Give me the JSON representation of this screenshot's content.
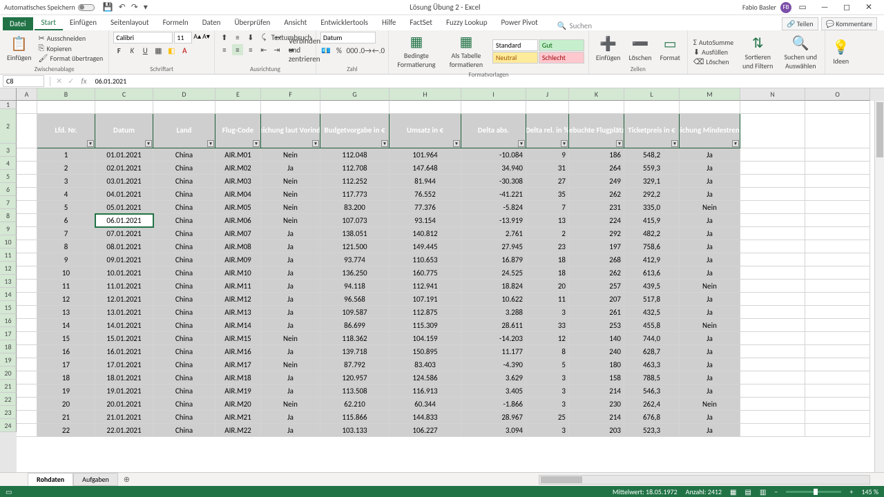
{
  "titlebar": {
    "autosave": "Automatisches Speichern",
    "file_title": "Lösung Übung 2 - Excel",
    "user_name": "Fabio Basler",
    "user_initials": "FB"
  },
  "tabs": {
    "file": "Datei",
    "items": [
      "Start",
      "Einfügen",
      "Seitenlayout",
      "Formeln",
      "Daten",
      "Überprüfen",
      "Ansicht",
      "Entwicklertools",
      "Hilfe",
      "FactSet",
      "Fuzzy Lookup",
      "Power Pivot"
    ],
    "active": "Start",
    "search_placeholder": "Suchen",
    "share": "Teilen",
    "comments": "Kommentare"
  },
  "ribbon": {
    "paste": "Einfügen",
    "cut": "Ausschneiden",
    "copy": "Kopieren",
    "format_painter": "Format übertragen",
    "clipboard_label": "Zwischenablage",
    "font_name": "Calibri",
    "font_size": "11",
    "font_label": "Schriftart",
    "wrap": "Textumbruch",
    "merge": "Verbinden und zentrieren",
    "align_label": "Ausrichtung",
    "num_format": "Datum",
    "num_label": "Zahl",
    "cond_fmt": "Bedingte Formatierung",
    "as_table": "Als Tabelle formatieren",
    "style_standard": "Standard",
    "style_gut": "Gut",
    "style_neutral": "Neutral",
    "style_schlecht": "Schlecht",
    "styles_label": "Formatvorlagen",
    "insert": "Einfügen",
    "delete": "Löschen",
    "format": "Format",
    "cells_label": "Zellen",
    "autosum": "AutoSumme",
    "fill": "Ausfüllen",
    "clear": "Löschen",
    "sort": "Sortieren und Filtern",
    "find": "Suchen und Auswählen",
    "ideas": "Ideen"
  },
  "formula_bar": {
    "cell_ref": "C8",
    "value": "06.01.2021"
  },
  "columns": [
    "A",
    "B",
    "C",
    "D",
    "E",
    "F",
    "G",
    "H",
    "I",
    "J",
    "K",
    "L",
    "M",
    "N",
    "O"
  ],
  "row_numbers": [
    "1",
    "2",
    "3",
    "4",
    "5",
    "6",
    "7",
    "8",
    "9",
    "10",
    "11",
    "12",
    "13",
    "14",
    "15",
    "16",
    "17",
    "18",
    "19",
    "20",
    "21",
    "22",
    "23",
    "24"
  ],
  "headers": [
    "Lfd. Nr.",
    "Datum",
    "Land",
    "Flug-Code",
    "Zielerreichung laut Vorindikation",
    "Budgetvorgabe in €",
    "Umsatz in €",
    "Delta abs.",
    "Delta rel. in %",
    "Gebuchte Flugplätze",
    "Ticketpreis in €",
    "Erreichung Mindestrendite"
  ],
  "chart_data": {
    "type": "table",
    "rows": [
      {
        "nr": "1",
        "datum": "01.01.2021",
        "land": "China",
        "code": "AIR.M01",
        "ziel": "Nein",
        "budget": "112.048",
        "umsatz": "101.964",
        "dabs": "-10.084",
        "drel": "9",
        "plaetze": "186",
        "preis": "548,2",
        "rendite": "Ja"
      },
      {
        "nr": "2",
        "datum": "02.01.2021",
        "land": "China",
        "code": "AIR.M02",
        "ziel": "Ja",
        "budget": "112.708",
        "umsatz": "147.648",
        "dabs": "34.940",
        "drel": "31",
        "plaetze": "264",
        "preis": "559,3",
        "rendite": "Ja"
      },
      {
        "nr": "3",
        "datum": "03.01.2021",
        "land": "China",
        "code": "AIR.M03",
        "ziel": "Nein",
        "budget": "112.252",
        "umsatz": "81.944",
        "dabs": "-30.308",
        "drel": "27",
        "plaetze": "249",
        "preis": "329,1",
        "rendite": "Ja"
      },
      {
        "nr": "4",
        "datum": "04.01.2021",
        "land": "China",
        "code": "AIR.M04",
        "ziel": "Nein",
        "budget": "117.773",
        "umsatz": "76.552",
        "dabs": "-41.221",
        "drel": "35",
        "plaetze": "262",
        "preis": "292,2",
        "rendite": "Ja"
      },
      {
        "nr": "5",
        "datum": "05.01.2021",
        "land": "China",
        "code": "AIR.M05",
        "ziel": "Nein",
        "budget": "83.200",
        "umsatz": "77.376",
        "dabs": "-5.824",
        "drel": "7",
        "plaetze": "231",
        "preis": "335,0",
        "rendite": "Nein"
      },
      {
        "nr": "6",
        "datum": "06.01.2021",
        "land": "China",
        "code": "AIR.M06",
        "ziel": "Nein",
        "budget": "107.073",
        "umsatz": "93.154",
        "dabs": "-13.919",
        "drel": "13",
        "plaetze": "224",
        "preis": "415,9",
        "rendite": "Ja"
      },
      {
        "nr": "7",
        "datum": "07.01.2021",
        "land": "China",
        "code": "AIR.M07",
        "ziel": "Ja",
        "budget": "138.051",
        "umsatz": "140.812",
        "dabs": "2.761",
        "drel": "2",
        "plaetze": "292",
        "preis": "482,2",
        "rendite": "Ja"
      },
      {
        "nr": "8",
        "datum": "08.01.2021",
        "land": "China",
        "code": "AIR.M08",
        "ziel": "Ja",
        "budget": "121.500",
        "umsatz": "149.445",
        "dabs": "27.945",
        "drel": "23",
        "plaetze": "197",
        "preis": "758,6",
        "rendite": "Ja"
      },
      {
        "nr": "9",
        "datum": "09.01.2021",
        "land": "China",
        "code": "AIR.M09",
        "ziel": "Ja",
        "budget": "93.774",
        "umsatz": "110.653",
        "dabs": "16.879",
        "drel": "18",
        "plaetze": "268",
        "preis": "412,9",
        "rendite": "Ja"
      },
      {
        "nr": "10",
        "datum": "10.01.2021",
        "land": "China",
        "code": "AIR.M10",
        "ziel": "Ja",
        "budget": "136.250",
        "umsatz": "160.775",
        "dabs": "24.525",
        "drel": "18",
        "plaetze": "262",
        "preis": "613,6",
        "rendite": "Ja"
      },
      {
        "nr": "11",
        "datum": "11.01.2021",
        "land": "China",
        "code": "AIR.M11",
        "ziel": "Ja",
        "budget": "94.118",
        "umsatz": "112.941",
        "dabs": "18.824",
        "drel": "20",
        "plaetze": "257",
        "preis": "439,5",
        "rendite": "Nein"
      },
      {
        "nr": "12",
        "datum": "12.01.2021",
        "land": "China",
        "code": "AIR.M12",
        "ziel": "Ja",
        "budget": "96.568",
        "umsatz": "107.191",
        "dabs": "10.622",
        "drel": "11",
        "plaetze": "207",
        "preis": "517,8",
        "rendite": "Ja"
      },
      {
        "nr": "13",
        "datum": "13.01.2021",
        "land": "China",
        "code": "AIR.M13",
        "ziel": "Ja",
        "budget": "109.587",
        "umsatz": "112.875",
        "dabs": "3.288",
        "drel": "3",
        "plaetze": "261",
        "preis": "432,5",
        "rendite": "Ja"
      },
      {
        "nr": "14",
        "datum": "14.01.2021",
        "land": "China",
        "code": "AIR.M14",
        "ziel": "Ja",
        "budget": "86.699",
        "umsatz": "115.309",
        "dabs": "28.611",
        "drel": "33",
        "plaetze": "253",
        "preis": "455,8",
        "rendite": "Nein"
      },
      {
        "nr": "15",
        "datum": "15.01.2021",
        "land": "China",
        "code": "AIR.M15",
        "ziel": "Nein",
        "budget": "118.362",
        "umsatz": "104.159",
        "dabs": "-14.203",
        "drel": "12",
        "plaetze": "140",
        "preis": "744,0",
        "rendite": "Ja"
      },
      {
        "nr": "16",
        "datum": "16.01.2021",
        "land": "China",
        "code": "AIR.M16",
        "ziel": "Ja",
        "budget": "139.718",
        "umsatz": "150.895",
        "dabs": "11.177",
        "drel": "8",
        "plaetze": "240",
        "preis": "628,7",
        "rendite": "Ja"
      },
      {
        "nr": "17",
        "datum": "17.01.2021",
        "land": "China",
        "code": "AIR.M17",
        "ziel": "Nein",
        "budget": "87.792",
        "umsatz": "83.403",
        "dabs": "-4.390",
        "drel": "5",
        "plaetze": "180",
        "preis": "463,3",
        "rendite": "Ja"
      },
      {
        "nr": "18",
        "datum": "18.01.2021",
        "land": "China",
        "code": "AIR.M18",
        "ziel": "Ja",
        "budget": "120.957",
        "umsatz": "124.586",
        "dabs": "3.629",
        "drel": "3",
        "plaetze": "158",
        "preis": "788,5",
        "rendite": "Ja"
      },
      {
        "nr": "19",
        "datum": "19.01.2021",
        "land": "China",
        "code": "AIR.M19",
        "ziel": "Ja",
        "budget": "113.508",
        "umsatz": "116.913",
        "dabs": "3.405",
        "drel": "3",
        "plaetze": "214",
        "preis": "546,3",
        "rendite": "Ja"
      },
      {
        "nr": "20",
        "datum": "20.01.2021",
        "land": "China",
        "code": "AIR.M20",
        "ziel": "Nein",
        "budget": "62.210",
        "umsatz": "60.344",
        "dabs": "-1.866",
        "drel": "3",
        "plaetze": "230",
        "preis": "262,4",
        "rendite": "Nein"
      },
      {
        "nr": "21",
        "datum": "21.01.2021",
        "land": "China",
        "code": "AIR.M21",
        "ziel": "Ja",
        "budget": "115.866",
        "umsatz": "144.833",
        "dabs": "28.967",
        "drel": "25",
        "plaetze": "214",
        "preis": "676,8",
        "rendite": "Ja"
      },
      {
        "nr": "22",
        "datum": "22.01.2021",
        "land": "China",
        "code": "AIR.M22",
        "ziel": "Ja",
        "budget": "103.133",
        "umsatz": "106.227",
        "dabs": "3.094",
        "drel": "3",
        "plaetze": "203",
        "preis": "523,3",
        "rendite": "Ja"
      }
    ]
  },
  "sheets": {
    "active": "Rohdaten",
    "other": "Aufgaben"
  },
  "status": {
    "avg_label": "Mittelwert:",
    "avg": "18.05.1972",
    "count_label": "Anzahl:",
    "count": "2412",
    "zoom": "145 %"
  }
}
